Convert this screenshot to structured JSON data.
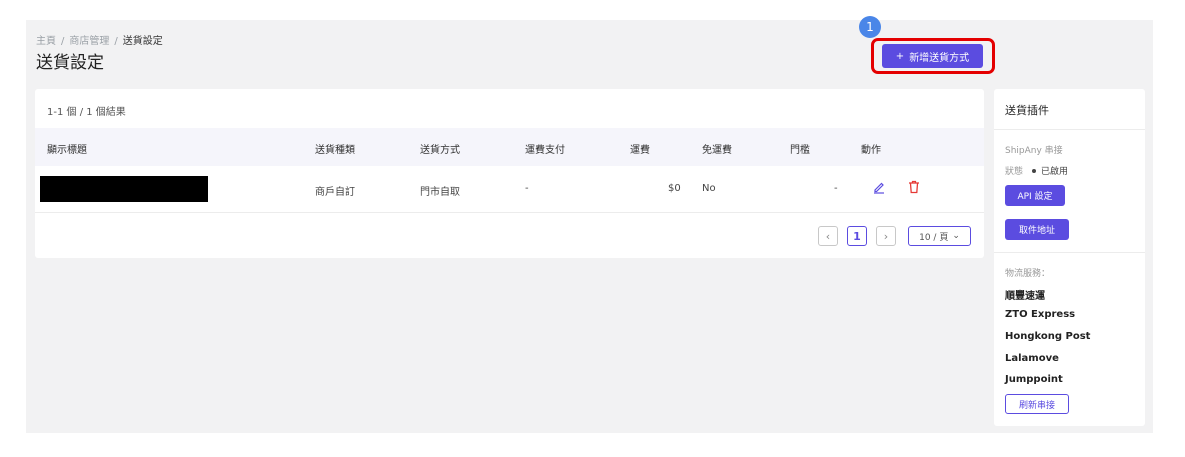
{
  "breadcrumb": {
    "home": "主頁",
    "store": "商店管理",
    "current": "送貨設定",
    "sep": "/"
  },
  "page": {
    "title": "送貨設定"
  },
  "step_badge": "1",
  "add_button": {
    "icon": "+",
    "label": "新增送貨方式"
  },
  "table": {
    "count": "1-1 個 / 1 個結果",
    "columns": [
      "顯示標題",
      "送貨種類",
      "送貨方式",
      "運費支付",
      "運費",
      "免運費",
      "門檻",
      "動作"
    ],
    "rows": [
      {
        "title": "",
        "type": "商戶自訂",
        "method": "門市自取",
        "payment": "-",
        "fee": "$0",
        "free": "No",
        "threshold": "-"
      }
    ]
  },
  "pagination": {
    "prev": "‹",
    "page": "1",
    "next": "›",
    "size": "10 / 頁",
    "size_icon": "⌄"
  },
  "plugin": {
    "title": "送貨插件",
    "provider": "ShipAny 串接",
    "status_label": "狀態",
    "status_value": "已啟用",
    "api_button": "API 設定",
    "pickup_button": "取件地址",
    "services_label": "物流服務：",
    "services": [
      "順豐速運",
      "ZTO Express",
      "Hongkong Post",
      "Lalamove",
      "Jumppoint"
    ],
    "refresh_button": "刷新串接"
  },
  "colors": {
    "accent": "#5b4ce0",
    "highlight": "#e40000",
    "badge": "#4a86e8",
    "delete": "#e53935"
  }
}
